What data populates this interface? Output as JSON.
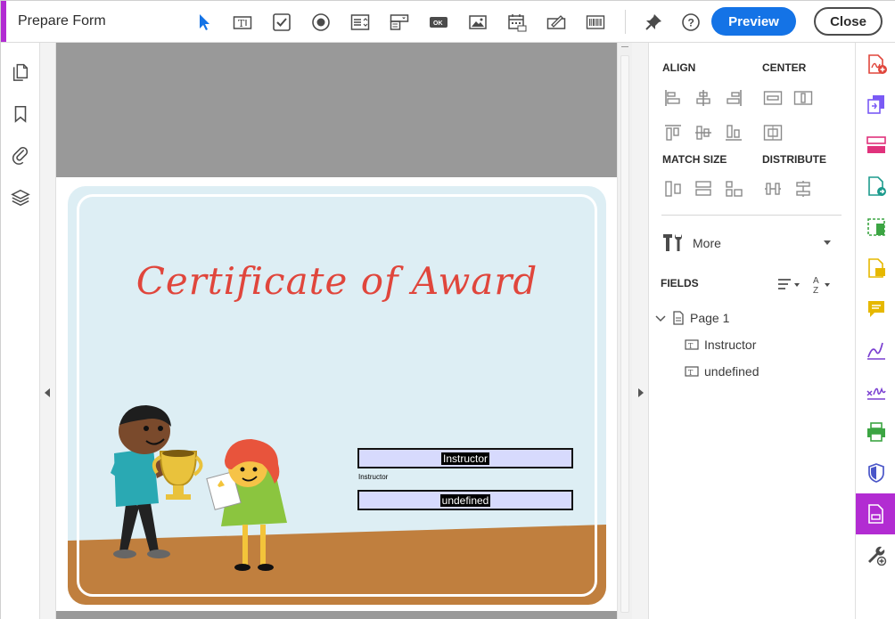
{
  "header": {
    "title": "Prepare Form",
    "preview_label": "Preview",
    "close_label": "Close",
    "help_glyph": "?",
    "toolbar_icons": [
      "select-pointer-icon",
      "text-field-icon",
      "checkbox-icon",
      "radio-button-icon",
      "list-box-icon",
      "dropdown-icon",
      "button-icon",
      "image-icon",
      "date-field-icon",
      "signature-field-icon",
      "barcode-icon",
      "pin-icon",
      "help-icon"
    ],
    "button_glyph": "OK",
    "text_field_glyph": "T"
  },
  "left_rail": {
    "icons": [
      "page-thumbnails-icon",
      "bookmarks-icon",
      "attachments-icon",
      "layers-icon"
    ]
  },
  "document": {
    "certificate_title": "Certificate of Award",
    "fields": [
      {
        "name": "Instructor",
        "value": "Instructor",
        "caption": "Instructor"
      },
      {
        "name": "undefined",
        "value": "undefined"
      }
    ]
  },
  "right_panel": {
    "align_label": "ALIGN",
    "center_label": "CENTER",
    "match_size_label": "MATCH SIZE",
    "distribute_label": "DISTRIBUTE",
    "more_label": "More",
    "fields_label": "FIELDS",
    "sort_glyph": "A",
    "sort_glyph_2": "Z",
    "tree": {
      "page_label": "Page 1",
      "items": [
        "Instructor",
        "undefined"
      ]
    }
  },
  "tool_rail": {
    "icons": [
      "create-pdf-icon",
      "combine-files-icon",
      "organize-pages-icon",
      "export-pdf-icon",
      "edit-pdf-icon",
      "comment-icon",
      "sticky-note-icon",
      "fill-sign-icon",
      "request-signature-icon",
      "print-production-icon",
      "protect-icon",
      "prepare-form-icon",
      "more-tools-icon"
    ],
    "active": "prepare-form-icon"
  },
  "colors": {
    "accent": "#b22cd2",
    "primary": "#1473e6",
    "title_red": "#e0463c",
    "field_fill": "#d7dafd",
    "floor": "#c07f3e",
    "sky": "#ddeef4"
  }
}
